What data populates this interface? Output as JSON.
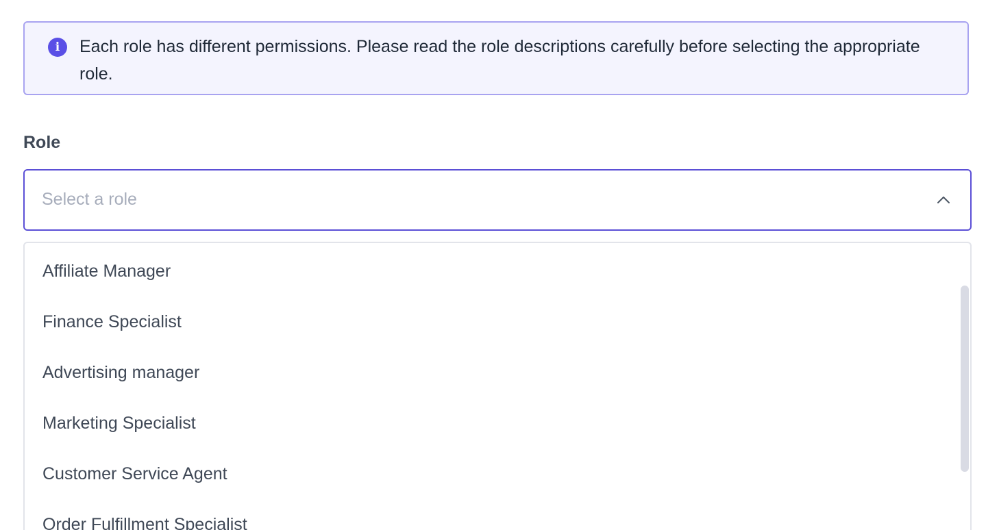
{
  "info_banner": {
    "icon": "info-icon",
    "icon_glyph": "i",
    "text": "Each role has different permissions. Please read the role descriptions carefully before selecting the appropriate role."
  },
  "role_field": {
    "label": "Role",
    "placeholder": "Select a role",
    "chevron": "chevron-up-icon"
  },
  "dropdown": {
    "options": [
      "Affiliate Manager",
      "Finance Specialist",
      "Advertising manager",
      "Marketing Specialist",
      "Customer Service Agent",
      "Order Fulfillment Specialist"
    ]
  },
  "colors": {
    "accent": "#5b4fd6",
    "banner_bg": "#f4f4fe",
    "banner_border": "#a8a3f0",
    "placeholder": "#a7adbb",
    "text": "#3f4856"
  }
}
